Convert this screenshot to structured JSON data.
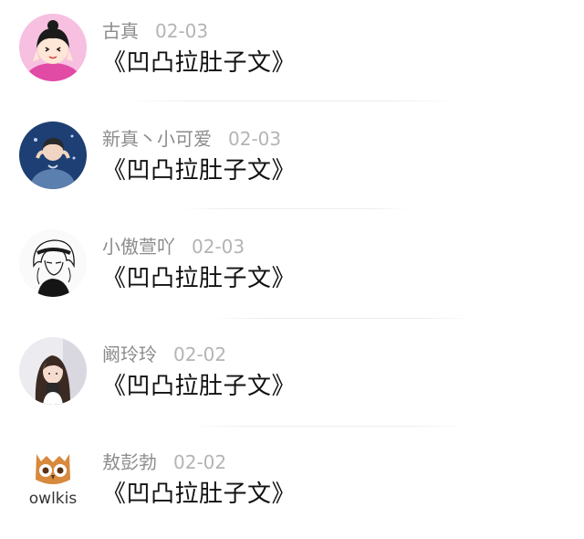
{
  "comments": [
    {
      "username": "古真",
      "date": "02-03",
      "text": "《凹凸拉肚子文》",
      "avatar_icon": "girl-peace-sign-avatar-icon"
    },
    {
      "username": "新真丶小可爱",
      "date": "02-03",
      "text": "《凹凸拉肚子文》",
      "avatar_icon": "boy-heart-hands-avatar-icon"
    },
    {
      "username": "小傲萱吖",
      "date": "02-03",
      "text": "《凹凸拉肚子文》",
      "avatar_icon": "sketch-girl-avatar-icon"
    },
    {
      "username": "阚玲玲",
      "date": "02-02",
      "text": "《凹凸拉肚子文》",
      "avatar_icon": "girl-photo-avatar-icon"
    },
    {
      "username": "敖彭勃",
      "date": "02-02",
      "text": "《凹凸拉肚子文》",
      "avatar_icon": "owl-logo-avatar-icon",
      "avatar_logo_text": "owlkis"
    }
  ]
}
